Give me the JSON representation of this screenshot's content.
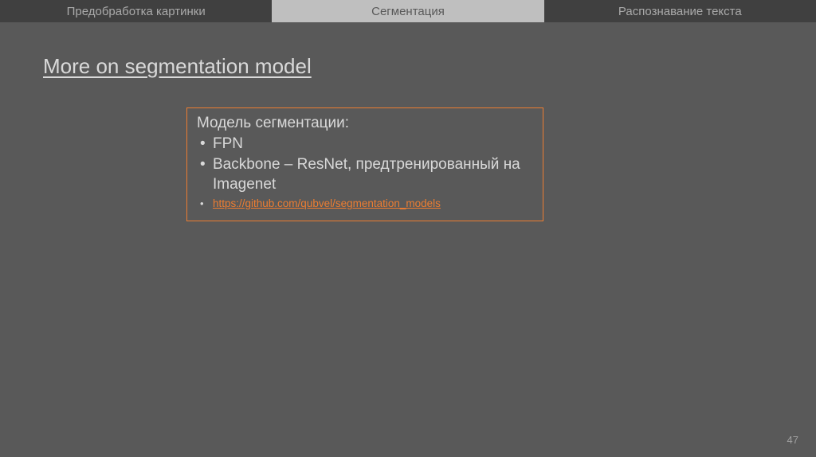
{
  "tabs": {
    "left": "Предобработка картинки",
    "center": "Сегментация",
    "right": "Распознавание текста"
  },
  "heading": "More on segmentation model",
  "box": {
    "title": "Модель сегментации:",
    "bullet1": "FPN",
    "bullet2": "Backbone – ResNet, предтренированный на Imagenet",
    "link": "https://github.com/qubvel/segmentation_models"
  },
  "pageNumber": "47"
}
